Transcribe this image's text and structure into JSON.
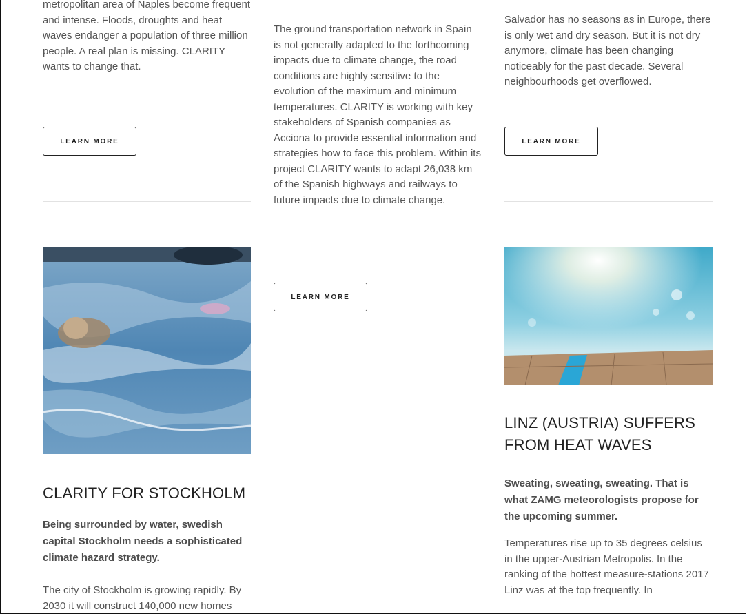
{
  "column1": {
    "intro_text": "metropolitan area of Naples become frequent and intense. Floods, droughts and heat waves endanger a population of three million people. A real plan is missing. CLARITY wants to change that.",
    "button_label": "LEARN MORE",
    "article": {
      "title": "CLARITY FOR STOCKHOLM",
      "lead": "Being surrounded by water, swedish capital Stockholm needs a sophisticated climate hazard strategy.",
      "body": "The city of Stockholm is growing rapidly. By 2030 it will construct 140,000 new homes"
    }
  },
  "column2": {
    "intro_text": "The ground transportation network in Spain is not generally adapted to the forthcoming impacts due to climate change, the road conditions are highly sensitive to the evolution of the maximum and minimum temperatures. CLARITY is working with key stakeholders of Spanish companies as Acciona to provide essential information and strategies how to face this problem. Within its project CLARITY wants to adapt 26,038 km of the Spanish highways and railways to future impacts due to climate change.",
    "button_label": "LEARN MORE"
  },
  "column3": {
    "intro_text": "Salvador has no seasons as in Europe, there is only wet and dry season. But it is not dry anymore, climate has been changing noticeably for the past decade. Several neighbourhoods get overflowed.",
    "button_label": "LEARN MORE",
    "article": {
      "title": "LINZ (AUSTRIA) SUFFERS FROM HEAT WAVES",
      "lead": "Sweating, sweating, sweating. That is what ZAMG meteorologists propose for the upcoming summer.",
      "body": "Temperatures rise up to 35 degrees celsius in the upper-Austrian Metropolis. In the ranking of the hottest measure-stations 2017 Linz was at the top frequently. In"
    }
  },
  "colors": {
    "text": "#555555",
    "heading": "#222222",
    "divider": "#e2e2e2",
    "button_border": "#222222"
  }
}
